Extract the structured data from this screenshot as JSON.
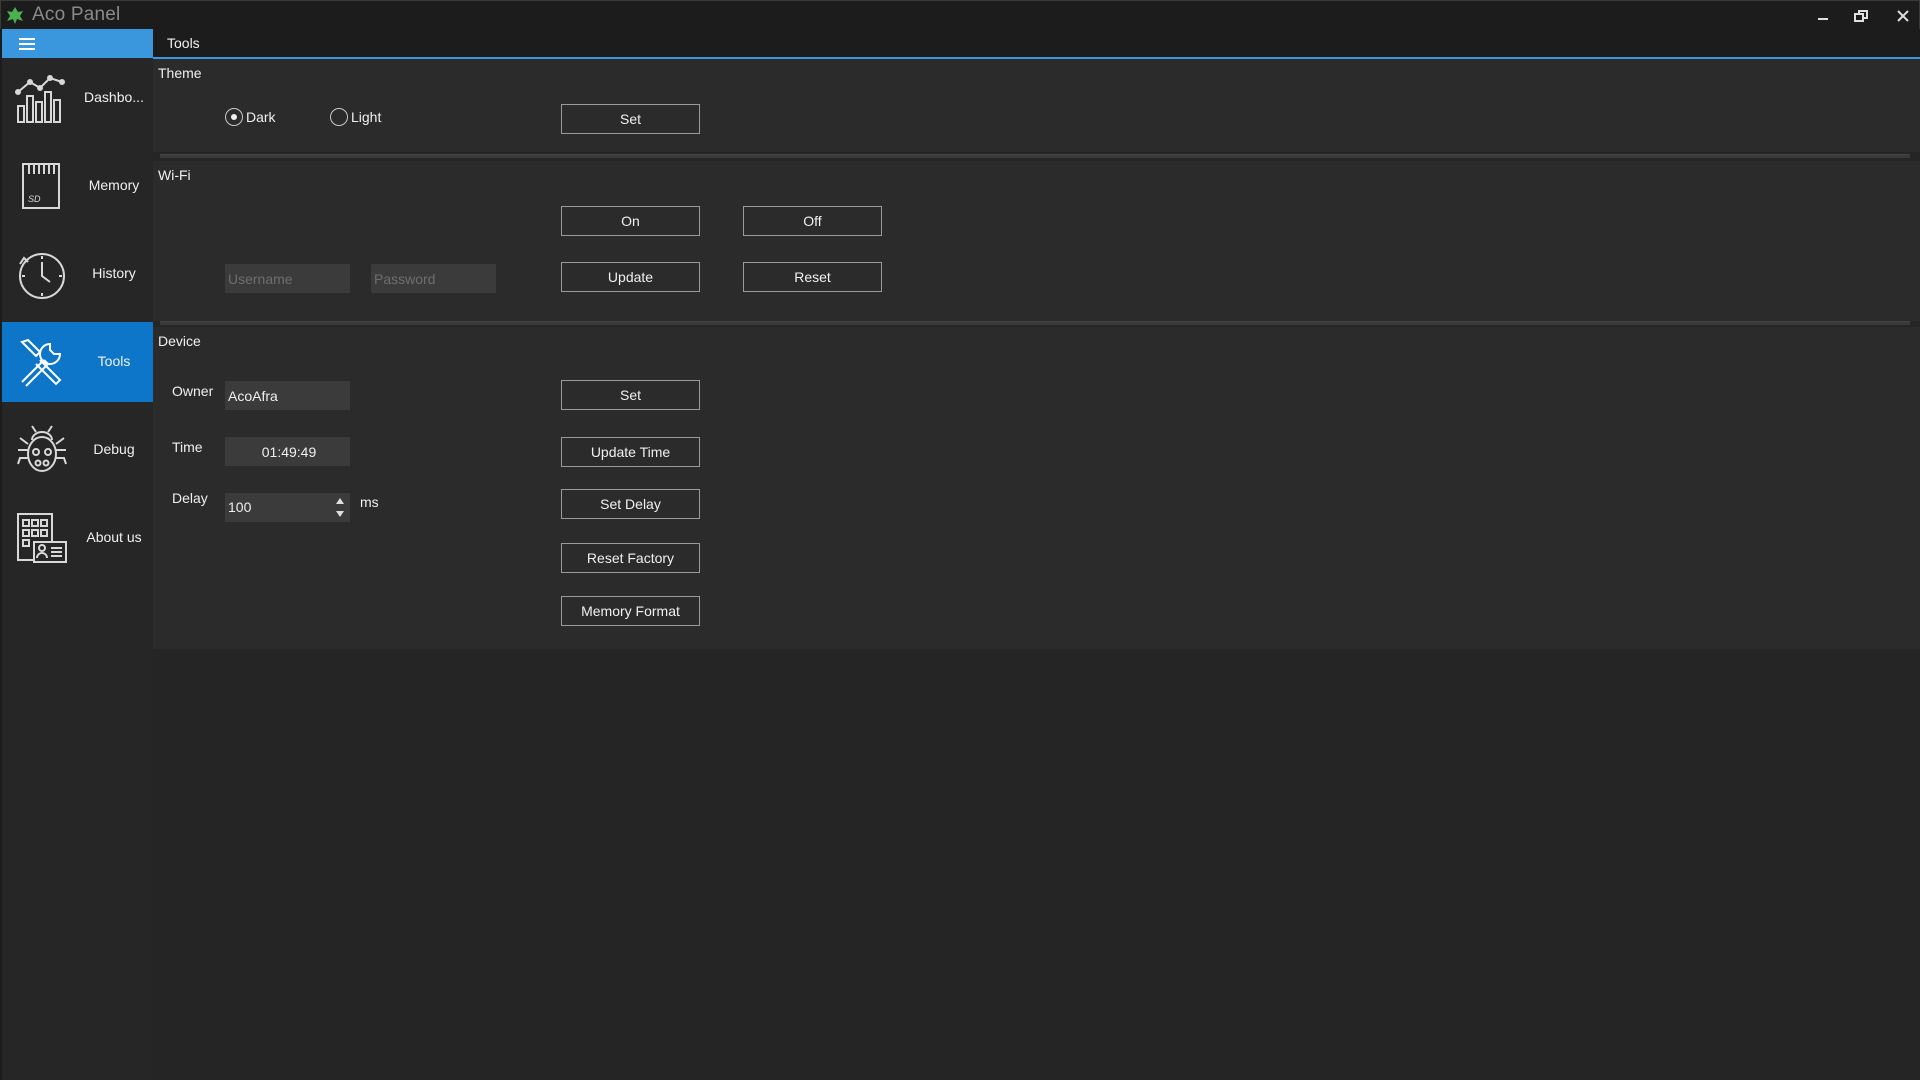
{
  "window": {
    "title": "Aco Panel",
    "minimize_icon": "minimize-icon",
    "restore_icon": "restore-icon",
    "close_icon": "close-icon"
  },
  "sidebar": {
    "toggle_icon": "hamburger-icon",
    "items": [
      {
        "label": "Dashbo...",
        "icon": "dashboard-chart-icon",
        "active": false
      },
      {
        "label": "Memory",
        "icon": "sd-card-icon",
        "active": false
      },
      {
        "label": "History",
        "icon": "clock-icon",
        "active": false
      },
      {
        "label": "Tools",
        "icon": "tools-icon",
        "active": true
      },
      {
        "label": "Debug",
        "icon": "bug-icon",
        "active": false
      },
      {
        "label": "About us",
        "icon": "about-card-icon",
        "active": false
      }
    ]
  },
  "tab": {
    "label": "Tools"
  },
  "theme": {
    "title": "Theme",
    "options": [
      {
        "label": "Dark",
        "selected": true
      },
      {
        "label": "Light",
        "selected": false
      }
    ],
    "set_label": "Set"
  },
  "wifi": {
    "title": "Wi-Fi",
    "on_label": "On",
    "off_label": "Off",
    "username_placeholder": "Username",
    "password_placeholder": "Password",
    "update_label": "Update",
    "reset_label": "Reset"
  },
  "device": {
    "title": "Device",
    "owner_label": "Owner",
    "owner_value": "AcoAfra",
    "owner_set_label": "Set",
    "time_label": "Time",
    "time_value": "01:49:49",
    "update_time_label": "Update Time",
    "delay_label": "Delay",
    "delay_value": "100",
    "delay_unit": "ms",
    "set_delay_label": "Set Delay",
    "reset_factory_label": "Reset Factory",
    "memory_format_label": "Memory Format"
  },
  "colors": {
    "accent": "#3a96dd",
    "active_nav": "#0e76c8",
    "background": "#252525",
    "panel": "#2b2b2b"
  }
}
